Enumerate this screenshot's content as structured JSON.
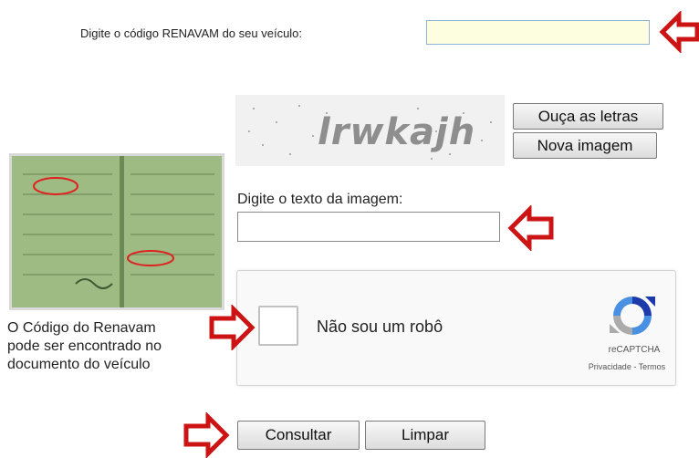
{
  "renavam": {
    "label": "Digite o código RENAVAM do seu veículo:",
    "value": ""
  },
  "captcha": {
    "image_text": "lrwkajh",
    "listen_button": "Ouça as letras",
    "new_image_button": "Nova imagem",
    "input_label": "Digite o texto da imagem:",
    "input_value": ""
  },
  "recaptcha": {
    "checkbox_label": "Não sou um robô",
    "brand": "reCAPTCHA",
    "privacy": "Privacidade",
    "separator": " - ",
    "terms": "Termos"
  },
  "document_caption": {
    "line1": "O Código do Renavam",
    "line2": "pode ser encontrado no",
    "line3": "documento do veículo"
  },
  "actions": {
    "submit": "Consultar",
    "clear": "Limpar"
  },
  "colors": {
    "annotation_arrow": "#cc1414",
    "recaptcha_blue": "#4a90e2",
    "recaptcha_gray": "#9e9e9e"
  },
  "icons": [
    "arrow-left-annotation-icon",
    "arrow-right-annotation-icon",
    "recaptcha-logo-icon",
    "vehicle-document-photo"
  ]
}
